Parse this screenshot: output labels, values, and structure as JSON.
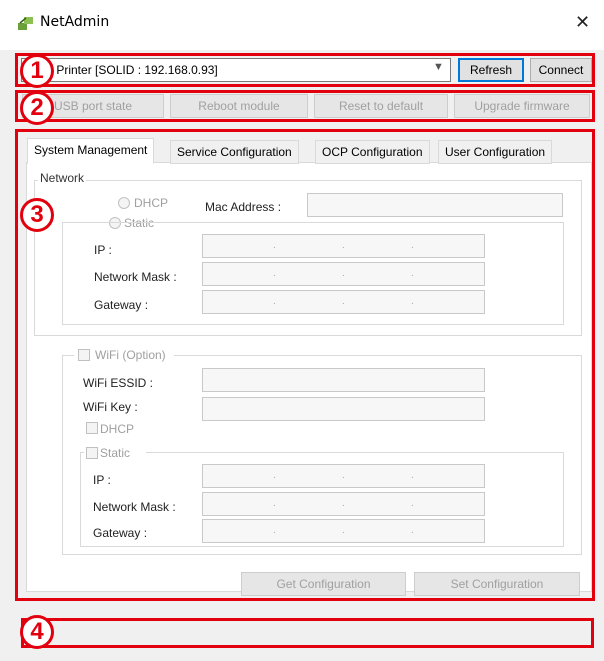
{
  "window": {
    "title": "NetAdmin",
    "close_glyph": "✕",
    "icon": "network-icon"
  },
  "toolbar": {
    "printer_combo": "Card Printer  [SOLID : 192.168.0.93]",
    "refresh_label": "Refresh",
    "connect_label": "Connect",
    "actions": [
      {
        "label": "USB port state"
      },
      {
        "label": "Reboot module"
      },
      {
        "label": "Reset to default"
      },
      {
        "label": "Upgrade firmware"
      }
    ]
  },
  "badges": {
    "b1": "1",
    "b2": "2",
    "b3": "3",
    "b4": "4"
  },
  "tabs": [
    {
      "label": "System Management",
      "active": true
    },
    {
      "label": "Service Configuration"
    },
    {
      "label": "OCP Configuration"
    },
    {
      "label": "User Configuration"
    }
  ],
  "network": {
    "group_label": "Network",
    "dhcp_label": "DHCP",
    "static_label": "Static",
    "mac_label": "Mac Address :",
    "ip_label": "IP :",
    "mask_label": "Network Mask :",
    "gateway_label": "Gateway :"
  },
  "wifi": {
    "option_label": "WiFi (Option)",
    "essid_label": "WiFi ESSID :",
    "key_label": "WiFi Key :",
    "dhcp_label": "DHCP",
    "static_label": "Static",
    "ip_label": "IP :",
    "mask_label": "Network Mask :",
    "gateway_label": "Gateway :"
  },
  "buttons": {
    "get_label": "Get Configuration",
    "set_label": "Set Configuration"
  },
  "ip_separator": "."
}
